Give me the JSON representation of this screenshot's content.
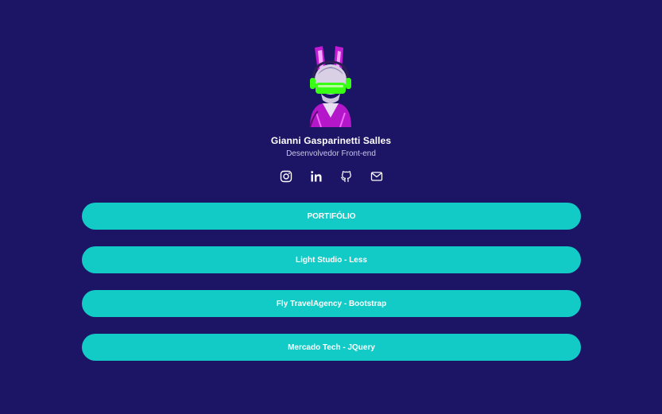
{
  "profile": {
    "name": "Gianni Gasparinetti Salles",
    "role": "Desenvolvedor Front-end",
    "avatar_icon": "bunny-cyber-avatar"
  },
  "socials": [
    {
      "icon": "instagram-icon"
    },
    {
      "icon": "linkedin-icon"
    },
    {
      "icon": "github-icon"
    },
    {
      "icon": "mail-icon"
    }
  ],
  "links": [
    {
      "label": "PORTIFÓLIO"
    },
    {
      "label": "Light Studio - Less"
    },
    {
      "label": "Fly TravelAgency - Bootstrap"
    },
    {
      "label": "Mercado Tech - JQuery"
    }
  ],
  "colors": {
    "background": "#1c1565",
    "button": "#12cbc7",
    "text": "#ffffff",
    "accent_green": "#39ff14",
    "accent_magenta": "#d01ee0"
  }
}
